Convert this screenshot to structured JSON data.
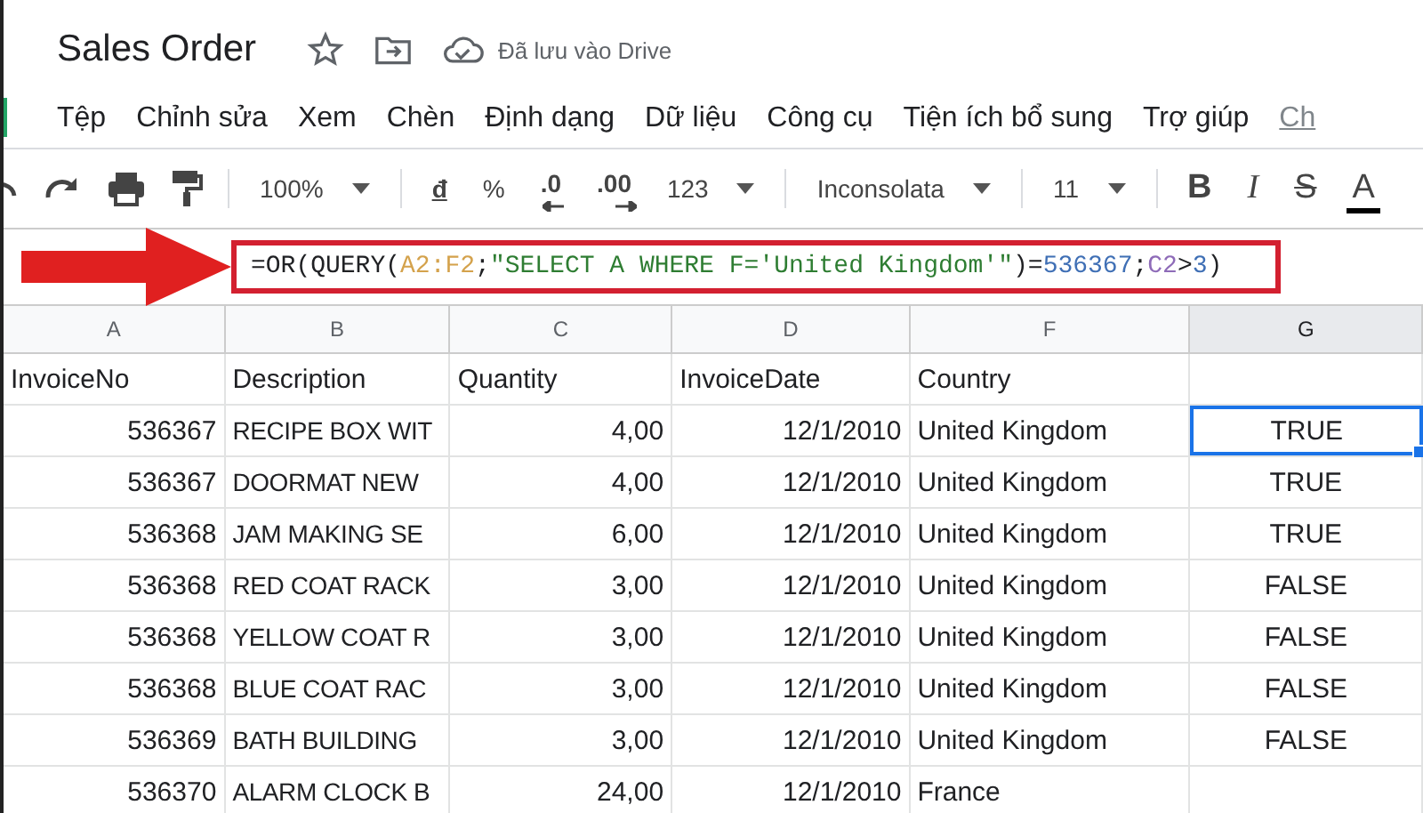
{
  "title": "Sales Order",
  "save_status": "Đã lưu vào Drive",
  "menu": [
    "Tệp",
    "Chỉnh sửa",
    "Xem",
    "Chèn",
    "Định dạng",
    "Dữ liệu",
    "Công cụ",
    "Tiện ích bổ sung",
    "Trợ giúp"
  ],
  "menu_overflow": "Ch",
  "toolbar": [
    {
      "kind": "undo"
    },
    {
      "kind": "redo"
    },
    {
      "kind": "print"
    },
    {
      "kind": "paint"
    },
    {
      "kind": "sep"
    },
    {
      "kind": "dropdown",
      "label": "100%"
    },
    {
      "kind": "sep"
    },
    {
      "kind": "currency",
      "label": "đ"
    },
    {
      "kind": "text",
      "label": "%"
    },
    {
      "kind": "dec-less",
      "label": ".0"
    },
    {
      "kind": "dec-more",
      "label": ".00"
    },
    {
      "kind": "dropdown",
      "label": "123"
    },
    {
      "kind": "sep"
    },
    {
      "kind": "dropdown",
      "label": "Inconsolata"
    },
    {
      "kind": "sep"
    },
    {
      "kind": "dropdown",
      "label": "11"
    },
    {
      "kind": "sep"
    },
    {
      "kind": "bold",
      "label": "B"
    },
    {
      "kind": "italic",
      "label": "I"
    },
    {
      "kind": "strike",
      "label": "S"
    },
    {
      "kind": "color-text",
      "label": "A"
    }
  ],
  "formula": [
    {
      "text": "=OR(QUERY(",
      "color": "#202124"
    },
    {
      "text": "A2:F2",
      "color": "#d4a24c"
    },
    {
      "text": ";",
      "color": "#202124"
    },
    {
      "text": "\"SELECT A WHERE F='United Kingdom'\"",
      "color": "#2e7d32"
    },
    {
      "text": ")=",
      "color": "#202124"
    },
    {
      "text": "536367",
      "color": "#3f6fb5"
    },
    {
      "text": ";",
      "color": "#202124"
    },
    {
      "text": "C2",
      "color": "#8e6bb8"
    },
    {
      "text": ">",
      "color": "#202124"
    },
    {
      "text": "3",
      "color": "#3f6fb5"
    },
    {
      "text": ")",
      "color": "#202124"
    }
  ],
  "columns": [
    {
      "label": "A",
      "selected": false
    },
    {
      "label": "B",
      "selected": false
    },
    {
      "label": "C",
      "selected": false
    },
    {
      "label": "D",
      "selected": false
    },
    {
      "label": "F",
      "selected": false
    },
    {
      "label": "G",
      "selected": true
    }
  ],
  "header_row": [
    "InvoiceNo",
    "Description",
    "Quantity",
    "InvoiceDate",
    "Country"
  ],
  "rows": [
    {
      "invoice_no": "536367",
      "description": "RECIPE BOX WIT",
      "quantity": "4,00",
      "invoice_date": "12/1/2010",
      "country": "United Kingdom",
      "result": "TRUE",
      "result_selected": true
    },
    {
      "invoice_no": "536367",
      "description": "DOORMAT NEW",
      "quantity": "4,00",
      "invoice_date": "12/1/2010",
      "country": "United Kingdom",
      "result": "TRUE",
      "result_selected": false
    },
    {
      "invoice_no": "536368",
      "description": "JAM MAKING SE",
      "quantity": "6,00",
      "invoice_date": "12/1/2010",
      "country": "United Kingdom",
      "result": "TRUE",
      "result_selected": false
    },
    {
      "invoice_no": "536368",
      "description": "RED COAT RACK",
      "quantity": "3,00",
      "invoice_date": "12/1/2010",
      "country": "United Kingdom",
      "result": "FALSE",
      "result_selected": false
    },
    {
      "invoice_no": "536368",
      "description": "YELLOW COAT R",
      "quantity": "3,00",
      "invoice_date": "12/1/2010",
      "country": "United Kingdom",
      "result": "FALSE",
      "result_selected": false
    },
    {
      "invoice_no": "536368",
      "description": "BLUE COAT RAC",
      "quantity": "3,00",
      "invoice_date": "12/1/2010",
      "country": "United Kingdom",
      "result": "FALSE",
      "result_selected": false
    },
    {
      "invoice_no": "536369",
      "description": "BATH BUILDING",
      "quantity": "3,00",
      "invoice_date": "12/1/2010",
      "country": "United Kingdom",
      "result": "FALSE",
      "result_selected": false
    },
    {
      "invoice_no": "536370",
      "description": "ALARM CLOCK B",
      "quantity": "24,00",
      "invoice_date": "12/1/2010",
      "country": "France",
      "result_selected": false
    }
  ]
}
